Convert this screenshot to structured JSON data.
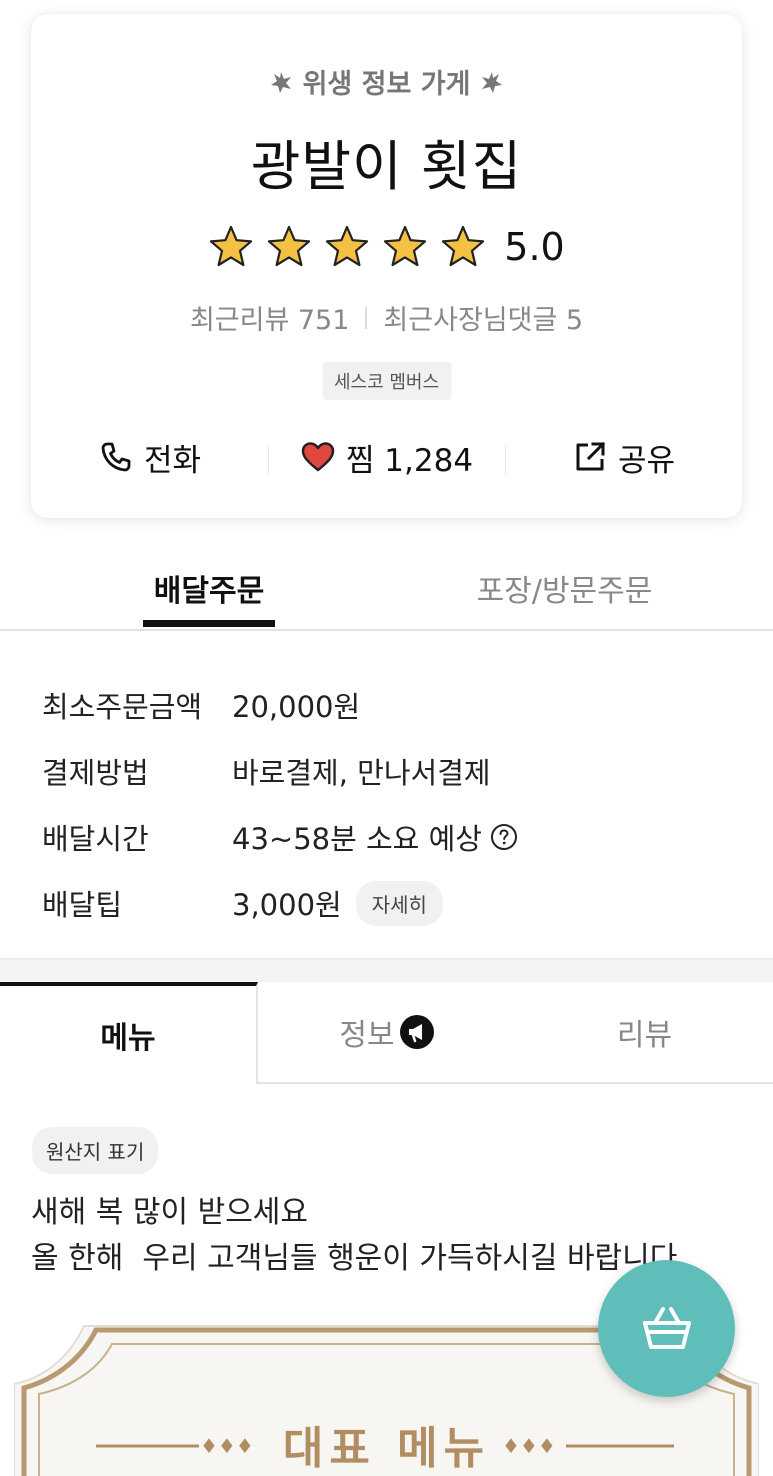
{
  "store": {
    "hygiene_label": "위생 정보 가게",
    "name": "광발이 횟집",
    "rating": 5,
    "rating_text": "5.0",
    "recent_reviews": "최근리뷰 751",
    "owner_replies": "최근사장님댓글 5",
    "badge": "세스코 멤버스"
  },
  "actions": {
    "call_label": "전화",
    "like_label": "찜 1,284",
    "share_label": "공유"
  },
  "order_tabs": {
    "delivery": "배달주문",
    "pickup": "포장/방문주문"
  },
  "order_info": [
    {
      "label": "최소주문금액",
      "value": "20,000원"
    },
    {
      "label": "결제방법",
      "value": "바로결제, 만나서결제"
    },
    {
      "label": "배달시간",
      "value": "43~58분 소요 예상"
    },
    {
      "label": "배달팁",
      "value": "3,000원"
    }
  ],
  "detail_chip": "자세히",
  "menu_tabs": {
    "menu": "메뉴",
    "info": "정보",
    "review": "리뷰"
  },
  "origin_chip": "원산지 표기",
  "notice": {
    "line1": "새해 복 많이 받으세요",
    "line2": "올 한해  우리 고객님들 행운이 가득하시길 바랍니다"
  },
  "representative_menu_title": "대표 메뉴",
  "colors": {
    "accent_teal": "#5fbeb9",
    "star_gold": "#f3c243",
    "heart_red": "#e2463f",
    "banner_gold": "#b18d62"
  },
  "icons": {
    "call": "phone-icon",
    "like": "heart-icon",
    "share": "share-icon",
    "help": "help-circle-icon",
    "info_badge": "megaphone-icon",
    "cart": "basket-icon"
  }
}
